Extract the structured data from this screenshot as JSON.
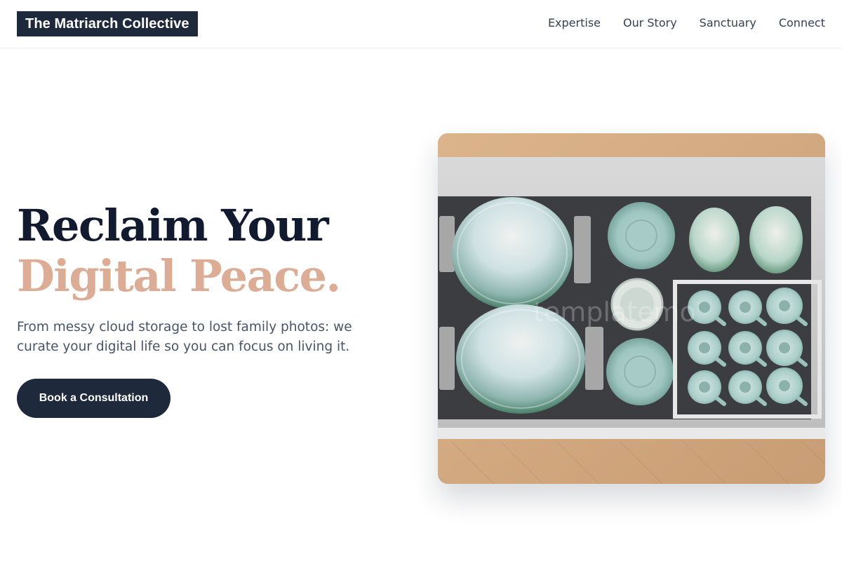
{
  "brand": {
    "name": "The Matriarch Collective"
  },
  "nav": {
    "items": [
      {
        "label": "Expertise"
      },
      {
        "label": "Our Story"
      },
      {
        "label": "Sanctuary"
      },
      {
        "label": "Connect"
      }
    ]
  },
  "hero": {
    "title_line1": "Reclaim Your",
    "title_line2": "Digital Peace.",
    "subtitle": "From messy cloud storage to lost family photos: we curate your digital life so you can focus on living it.",
    "cta_label": "Book a Consultation",
    "image_watermark": "templatemo"
  },
  "colors": {
    "navy": "#1e293b",
    "accent_peach": "#dcac95",
    "body_text": "#475569"
  }
}
